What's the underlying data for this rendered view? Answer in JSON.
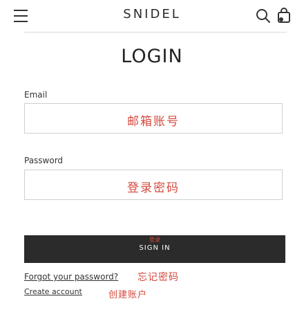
{
  "header": {
    "logo": "SNIDEL",
    "icons": {
      "menu": "hamburger-icon",
      "search": "search-icon",
      "bag": "shopping-bag-icon"
    }
  },
  "page_title": "LOGIN",
  "email": {
    "label": "Email",
    "annotation": "邮箱账号"
  },
  "password": {
    "label": "Password",
    "annotation": "登录密码"
  },
  "signin": {
    "label": "SIGN IN",
    "annotation": "登录"
  },
  "links": {
    "forgot": "Forgot your password?",
    "forgot_annotation": "忘记密码",
    "create": "Create account",
    "create_annotation": "创建账户"
  },
  "colors": {
    "annotation": "#d44a3e",
    "button": "#2b2b2b"
  }
}
